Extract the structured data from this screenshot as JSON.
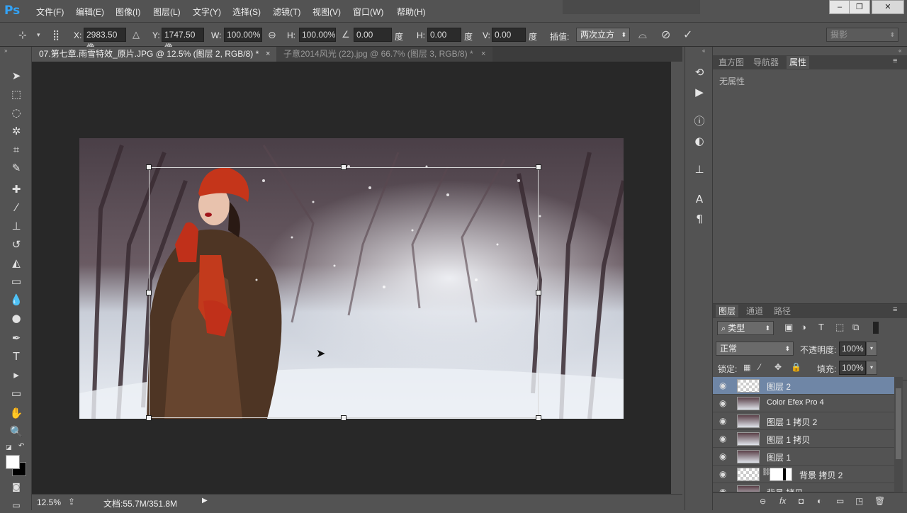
{
  "app": {
    "logo": "Ps"
  },
  "menu": [
    "文件(F)",
    "编辑(E)",
    "图像(I)",
    "图层(L)",
    "文字(Y)",
    "选择(S)",
    "滤镜(T)",
    "视图(V)",
    "窗口(W)",
    "帮助(H)"
  ],
  "window_buttons": {
    "minimize": "–",
    "restore": "❐",
    "close": "✕"
  },
  "options": {
    "x_label": "X:",
    "x_value": "2983.50 像",
    "y_label": "Y:",
    "y_value": "1747.50 像",
    "w_label": "W:",
    "w_value": "100.00%",
    "h_label": "H:",
    "h_value": "100.00%",
    "angle_value": "0.00",
    "angle_unit": "度",
    "hskew_label": "H:",
    "hskew_value": "0.00",
    "hskew_unit": "度",
    "vskew_label": "V:",
    "vskew_value": "0.00",
    "vskew_unit": "度",
    "interp_label": "插值:",
    "interp_value": "两次立方",
    "workspace": "摄影"
  },
  "tabs": [
    {
      "label": "07.第七章.雨雪特效_原片.JPG @ 12.5% (图层 2, RGB/8) *",
      "close": "×"
    },
    {
      "label": "子意2014风光 (22).jpg @ 66.7% (图层 3, RGB/8) *",
      "close": "×"
    }
  ],
  "status": {
    "zoom": "12.5%",
    "doc": "文档:55.7M/351.8M"
  },
  "properties_panel": {
    "tabs": [
      "直方图",
      "导航器",
      "属性"
    ],
    "body_text": "无属性"
  },
  "layers_panel": {
    "tabs": [
      "图层",
      "通道",
      "路径"
    ],
    "filter_label": "类型",
    "blend_mode": "正常",
    "opacity_label": "不透明度:",
    "opacity_value": "100%",
    "lock_label": "锁定:",
    "fill_label": "填充:",
    "fill_value": "100%",
    "layers": [
      {
        "name": "图层 2"
      },
      {
        "name": "Color Efex Pro 4"
      },
      {
        "name": "图层 1 拷贝 2"
      },
      {
        "name": "图层 1 拷贝"
      },
      {
        "name": "图层 1"
      },
      {
        "name": "背景 拷贝 2"
      },
      {
        "name": "背景 拷贝"
      }
    ]
  },
  "colors": {
    "accent": "#6f86a6",
    "canvas_bg": "#282828",
    "ui_bg": "#535353"
  }
}
